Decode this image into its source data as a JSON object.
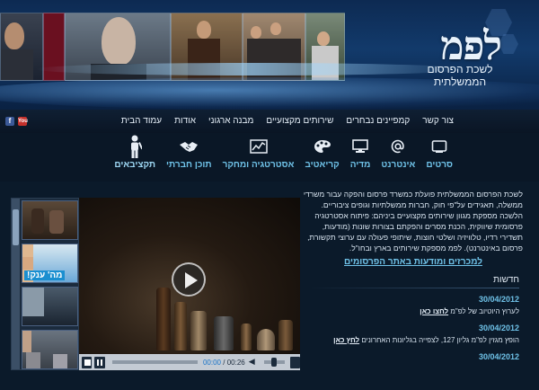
{
  "header": {
    "logo": "לפמ",
    "subtitle_line1": "לשכת הפרסום",
    "subtitle_line2": "הממשלתית"
  },
  "nav": {
    "items": [
      "עמוד הבית",
      "אודות",
      "מבנה ארגוני",
      "שירותים מקצועיים",
      "קמפיינים נבחרים",
      "צור קשר"
    ]
  },
  "social": {
    "youtube": "You",
    "facebook": "f"
  },
  "services": [
    {
      "label": "תקציבאים",
      "icon": "person-icon"
    },
    {
      "label": "תוכן חברתי",
      "icon": "handshake-icon"
    },
    {
      "label": "אסטרטגיה ומחקר",
      "icon": "chart-icon"
    },
    {
      "label": "קריאטיב",
      "icon": "palette-icon"
    },
    {
      "label": "מדיה",
      "icon": "monitor-icon"
    },
    {
      "label": "אינטרנט",
      "icon": "at-sign-icon"
    },
    {
      "label": "סרטים",
      "icon": "tv-icon"
    }
  ],
  "about": {
    "text": "לשכת הפרסום הממשלתית פועלת כמשרד פרסום והפקה עבור משרדי ממשלה, תאגידים על\"פי חוק, חברות ממשלתיות וגופים ציבוריים. הלשכה מספקת מגוון שירותים מקצועיים ביניהם: פיתוח אסטרטגיה פרסומית שיווקית, הכנת מסרים והפקתם בצורות שונות (מודעות, תשדירי רדיו, טלוויזיה ושלטי חוצות, שיתופי פעולה עם ערוצי תקשורת, פרסום באינטרנט). לפמ מספקת שירותים בארץ ובחו\"ל."
  },
  "tenders_link": "למכרזים ומודעות באתר הפרסומים",
  "news": {
    "title": "חדשות",
    "items": [
      {
        "date": "30/04/2012",
        "text": "לערוץ היוטיוב של לפ\"מ",
        "link": "לחצו כאן"
      },
      {
        "date": "30/04/2012",
        "text": "הופץ מגזין לפ\"מ גליון 127, לצפייה בגליונות האחרונים",
        "link": "לחץ כאן"
      },
      {
        "date": "30/04/2012",
        "text": "",
        "link": ""
      }
    ]
  },
  "video": {
    "current_time": "00:00",
    "total_time": "00:26",
    "thumbnail_badge": "מה' ענק!"
  },
  "colors": {
    "accent": "#6fc2e8",
    "background": "#0a1726",
    "banner": "#123a6b"
  }
}
